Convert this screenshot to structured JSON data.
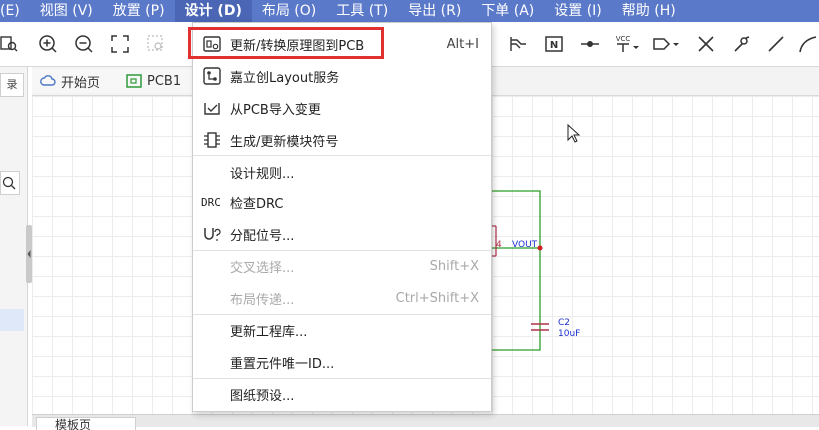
{
  "menubar": {
    "items": [
      {
        "label": "(E)"
      },
      {
        "label": "视图 (V)"
      },
      {
        "label": "放置 (P)"
      },
      {
        "label": "设计 (D)"
      },
      {
        "label": "布局 (O)"
      },
      {
        "label": "工具 (T)"
      },
      {
        "label": "导出 (R)"
      },
      {
        "label": "下单 (A)"
      },
      {
        "label": "设置 (I)"
      },
      {
        "label": "帮助 (H)"
      }
    ],
    "active_index": 3
  },
  "doc_tabs": [
    {
      "label": "开始页",
      "icon": "cloud-icon"
    },
    {
      "label": "PCB1",
      "icon": "pcb-icon"
    }
  ],
  "left_panel": {
    "tab_label": "录"
  },
  "bottom_tab": {
    "label": "模板页"
  },
  "dropdown": {
    "items": [
      {
        "label": "更新/转换原理图到PCB",
        "shortcut": "Alt+I",
        "icon": "update-pcb-icon",
        "disabled": false
      },
      {
        "label": "嘉立创Layout服务",
        "shortcut": "",
        "icon": "layout-service-icon",
        "disabled": false
      },
      {
        "label": "从PCB导入变更",
        "shortcut": "",
        "icon": "import-changes-icon",
        "disabled": false
      },
      {
        "label": "生成/更新模块符号",
        "shortcut": "",
        "icon": "module-symbol-icon",
        "disabled": false
      },
      {
        "label": "设计规则...",
        "shortcut": "",
        "icon": "",
        "disabled": false
      },
      {
        "label": "检查DRC",
        "shortcut": "",
        "icon": "drc-icon",
        "icon_text": "DRC",
        "disabled": false
      },
      {
        "label": "分配位号...",
        "shortcut": "",
        "icon": "annotate-icon",
        "disabled": false
      },
      {
        "label": "交叉选择...",
        "shortcut": "Shift+X",
        "icon": "",
        "disabled": true
      },
      {
        "label": "布局传递...",
        "shortcut": "Ctrl+Shift+X",
        "icon": "",
        "disabled": true
      },
      {
        "label": "更新工程库...",
        "shortcut": "",
        "icon": "",
        "disabled": false
      },
      {
        "label": "重置元件唯一ID...",
        "shortcut": "",
        "icon": "",
        "disabled": false
      },
      {
        "label": "图纸预设...",
        "shortcut": "",
        "icon": "",
        "disabled": false
      }
    ]
  },
  "schematic": {
    "pin_number": "4",
    "net_label": "VOUT",
    "cap_ref": "C2",
    "cap_value": "10uF"
  },
  "toolbar": {
    "vcc_label": "VCC",
    "netport_label": "N"
  },
  "colors": {
    "menubar_bg": "#5b79c9",
    "highlight": "#e03030",
    "wire": "#2a9d2a",
    "net_label": "#1a2fd0",
    "part_outline": "#b0304a"
  }
}
